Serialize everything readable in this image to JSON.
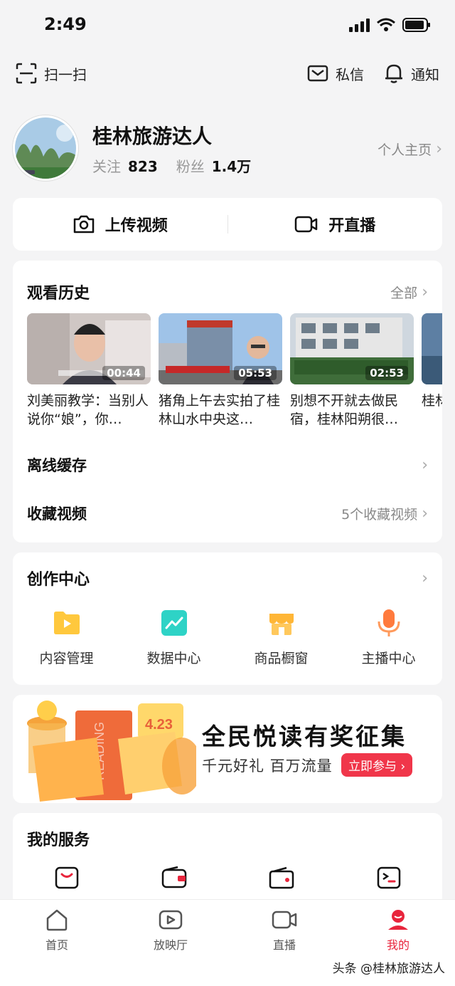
{
  "status": {
    "time": "2:49"
  },
  "topbar": {
    "scan_label": "扫一扫",
    "messages_label": "私信",
    "notify_label": "通知"
  },
  "profile": {
    "username": "桂林旅游达人",
    "following_label": "关注",
    "following_count": "823",
    "fans_label": "粉丝",
    "fans_count": "1.4万",
    "homepage_label": "个人主页"
  },
  "actions": {
    "upload_label": "上传视频",
    "live_label": "开直播"
  },
  "history": {
    "title": "观看历史",
    "more_label": "全部",
    "items": [
      {
        "duration": "00:44",
        "title": "刘美丽教学：当别人说你“娘”，你…"
      },
      {
        "duration": "05:53",
        "title": "猪角上午去实拍了桂林山水中央这…"
      },
      {
        "duration": "02:53",
        "title": "别想不开就去做民宿，桂林阳朔很…"
      },
      {
        "duration": "",
        "title": "桂林游…"
      }
    ],
    "offline_label": "离线缓存",
    "favorites_label": "收藏视频",
    "favorites_count": "5个收藏视频"
  },
  "creator": {
    "title": "创作中心",
    "tools": [
      {
        "label": "内容管理",
        "icon": "content-manage-icon",
        "color": "#ffc83d"
      },
      {
        "label": "数据中心",
        "icon": "data-center-icon",
        "color": "#2ed3c6"
      },
      {
        "label": "商品橱窗",
        "icon": "shop-window-icon",
        "color": "#ffb636"
      },
      {
        "label": "主播中心",
        "icon": "anchor-center-icon",
        "color": "#ff7a3d"
      }
    ]
  },
  "banner": {
    "title": "全民悦读有奖征集",
    "subtitle": "千元好礼 百万流量",
    "button_label": "立即参与 ›",
    "art_date": "4.23",
    "art_word": "READING"
  },
  "services": {
    "title": "我的服务"
  },
  "tabbar": {
    "tabs": [
      {
        "label": "首页",
        "icon": "home-icon"
      },
      {
        "label": "放映厅",
        "icon": "cinema-icon"
      },
      {
        "label": "直播",
        "icon": "live-icon"
      },
      {
        "label": "我的",
        "icon": "me-icon"
      }
    ],
    "active": "我的"
  },
  "watermark": "头条 @桂林旅游达人",
  "colors": {
    "accent": "#e8253c",
    "background": "#f4f4f5"
  }
}
